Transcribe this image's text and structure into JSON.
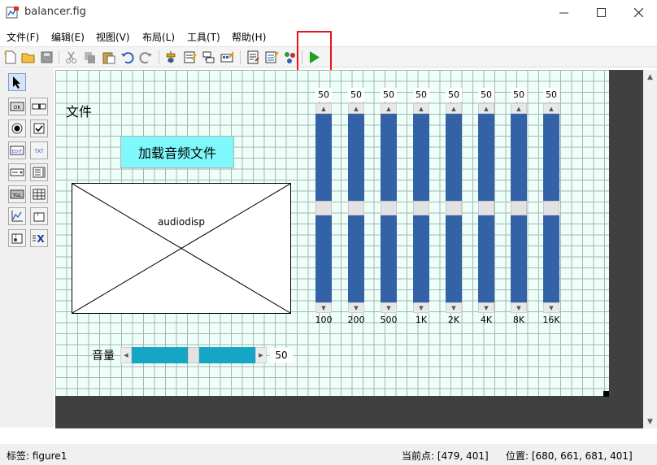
{
  "window": {
    "title": "balancer.fig"
  },
  "menu": [
    "文件(F)",
    "编辑(E)",
    "视图(V)",
    "布局(L)",
    "工具(T)",
    "帮助(H)"
  ],
  "canvas": {
    "file_label": "文件",
    "load_button": "加载音频文件",
    "axes_label": "audiodisp",
    "volume_label": "音量",
    "volume_value": "50",
    "volume_level": 0.5
  },
  "equalizer": {
    "bands": [
      {
        "label": "100",
        "value": "50",
        "level": 0.5
      },
      {
        "label": "200",
        "value": "50",
        "level": 0.5
      },
      {
        "label": "500",
        "value": "50",
        "level": 0.5
      },
      {
        "label": "1K",
        "value": "50",
        "level": 0.5
      },
      {
        "label": "2K",
        "value": "50",
        "level": 0.5
      },
      {
        "label": "4K",
        "value": "50",
        "level": 0.5
      },
      {
        "label": "8K",
        "value": "50",
        "level": 0.5
      },
      {
        "label": "16K",
        "value": "50",
        "level": 0.5
      }
    ]
  },
  "status": {
    "tag": "标签: figure1",
    "current_point": "当前点:  [479, 401]",
    "position": "位置: [680, 661, 681, 401]"
  },
  "colors": {
    "button_bg": "#7ff8fb",
    "eq_track": "#3462a6",
    "volume_track": "#17a5c5",
    "highlight": "#e8141a"
  }
}
